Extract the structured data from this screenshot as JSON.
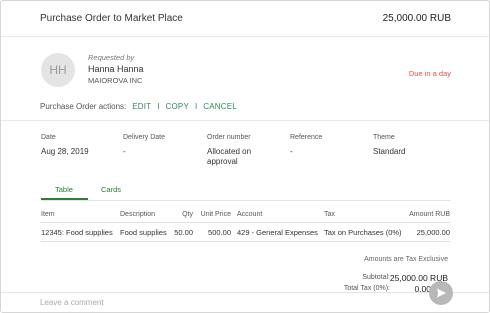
{
  "header": {
    "title": "Purchase Order to Market Place",
    "total": "25,000.00 RUB"
  },
  "requester": {
    "initials": "HH",
    "label": "Requested by",
    "name": "Hanna Hanna",
    "organization": "MAIOROVA INC",
    "due": "Due in a day"
  },
  "actions": {
    "label": "Purchase Order actions:",
    "edit": "EDIT",
    "copy": "COPY",
    "cancel": "CANCEL",
    "separator": "I"
  },
  "fields": [
    {
      "label": "Date",
      "value": "Aug 28, 2019"
    },
    {
      "label": "Delivery Date",
      "value": "-"
    },
    {
      "label": "Order number",
      "value": "Allocated on approval"
    },
    {
      "label": "Reference",
      "value": "-"
    },
    {
      "label": "Theme",
      "value": "Standard"
    }
  ],
  "tabs": {
    "table": "Table",
    "cards": "Cards",
    "active": "Table"
  },
  "table": {
    "headers": {
      "item": "Item",
      "description": "Description",
      "qty": "Qty",
      "unit_price": "Unit Price",
      "account": "Account",
      "tax": "Tax",
      "amount": "Amount RUB"
    },
    "rows": [
      {
        "item": "12345: Food supplies",
        "description": "Food supplies",
        "qty": "50.00",
        "unit_price": "500.00",
        "account": "429 - General Expenses",
        "tax": "Tax on Purchases (0%)",
        "amount": "25,000.00"
      }
    ]
  },
  "summary": {
    "note": "Amounts are Tax Exclusive",
    "subtotal_label": "Subtotal:",
    "subtotal_value": "25,000.00 RUB",
    "tax_label": "Total Tax (0%):",
    "tax_value": "0.00"
  },
  "comment": {
    "placeholder": "Leave a comment"
  },
  "colors": {
    "accent": "#2e7d32",
    "link": "#2e8b57",
    "due": "#d9534f"
  }
}
